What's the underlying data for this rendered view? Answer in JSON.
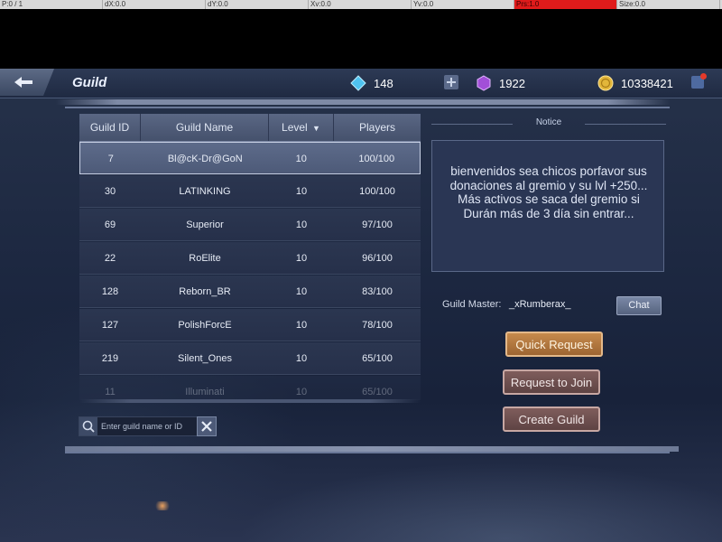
{
  "debug_bar": [
    "P:0 / 1",
    "dX:0.0",
    "dY:0.0",
    "Xv:0.0",
    "Yv:0.0",
    "Prs:1.0",
    "Size:0.0"
  ],
  "header": {
    "title": "Guild",
    "diamonds": "148",
    "gems": "1922",
    "gold": "10338421"
  },
  "table": {
    "columns": [
      "Guild ID",
      "Guild Name",
      "Level",
      "Players"
    ],
    "rows": [
      {
        "id": "7",
        "name": "Bl@cK-Dr@GoN",
        "level": "10",
        "players": "100/100"
      },
      {
        "id": "30",
        "name": "LATINKING",
        "level": "10",
        "players": "100/100"
      },
      {
        "id": "69",
        "name": "Superior",
        "level": "10",
        "players": "97/100"
      },
      {
        "id": "22",
        "name": "RoElite",
        "level": "10",
        "players": "96/100"
      },
      {
        "id": "128",
        "name": "Reborn_BR",
        "level": "10",
        "players": "83/100"
      },
      {
        "id": "127",
        "name": "PolishForcE",
        "level": "10",
        "players": "78/100"
      },
      {
        "id": "219",
        "name": "Silent_Ones",
        "level": "10",
        "players": "65/100"
      },
      {
        "id": "11",
        "name": "Illuminati",
        "level": "10",
        "players": "65/100"
      }
    ]
  },
  "search": {
    "placeholder": "Enter guild name or ID"
  },
  "notice": {
    "title": "Notice",
    "text": "bienvenidos sea chicos porfavor sus donaciones al gremio y su lvl +250... Más activos se saca del gremio si Durán más de 3 día sin entrar..."
  },
  "guild_master": {
    "label": "Guild Master:",
    "value": "_xRumberax_"
  },
  "buttons": {
    "chat": "Chat",
    "quick_request": "Quick Request",
    "request_join": "Request to Join",
    "create_guild": "Create Guild"
  },
  "colors": {
    "accent_orange": "#b57840",
    "selected_row": "#55627f",
    "panel_bg": "#1c2740"
  }
}
